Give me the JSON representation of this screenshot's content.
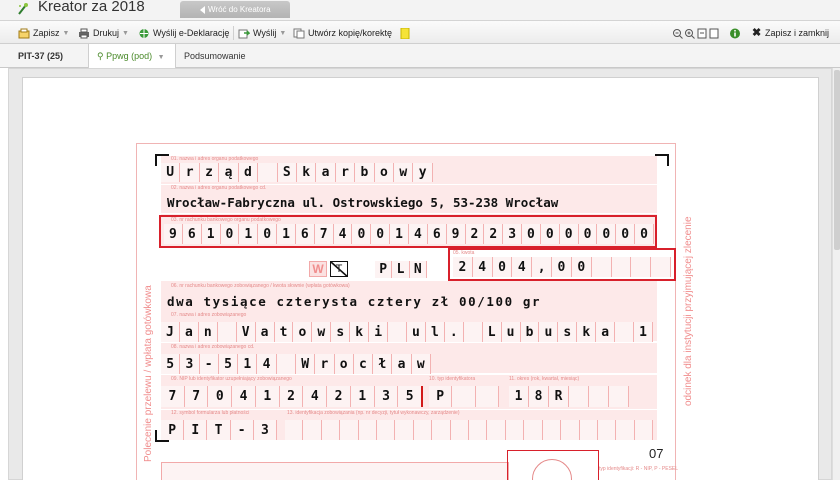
{
  "app": {
    "title": "Kreator za 2018",
    "back_tab": "Wróć do Kreatora"
  },
  "toolbar": {
    "save": "Zapisz",
    "print": "Drukuj",
    "send_edeklaracje": "Wyślij e-Deklarację",
    "send": "Wyślij",
    "copy": "Utwórz kopię/korektę",
    "save_close": "Zapisz i zamknij"
  },
  "tabs": [
    {
      "label": "PIT-37 (25)"
    },
    {
      "label": "Ppwg (pod)"
    },
    {
      "label": "Podsumowanie"
    }
  ],
  "form": {
    "vertical_left": "Polecenie przelewu / wpłata gotówkowa",
    "vertical_right": "odcinek dla instytucji przyjmującej zlecenie",
    "labels": {
      "f01": "01. nazwa i adres organu podatkowego",
      "f02": "02. nazwa i adres organu podatkowego cd.",
      "f03": "03. nr rachunku bankowego organu podatkowego",
      "f05": "05. kwota",
      "f06": "06. nr rachunku bankowego zobowiązanego / kwota słownie (wpłata gotówkowa)",
      "f07": "07. nazwa i adres zobowiązanego",
      "f08": "08. nazwa i adres zobowiązanego cd.",
      "f09": "09. NIP lub identyfikator uzupełniający zobowiązanego",
      "f10": "10. typ identyfikatora",
      "f11": "11. okres (rok, kwartał, miesiąc)",
      "f12": "12. symbol formularza lub płatności",
      "f13": "13. identyfikacja zobowiązania (np. nr decyzji, tytuł wykonawczy, zarządzenie)",
      "f14": "typ identyfikacji: R - NIP, P - PESEL"
    },
    "line1": "Urząd Skarbowy",
    "line2": "Wrocław-Fabryczna ul. Ostrowskiego 5, 53-238 Wrocław",
    "account": "96101016740014692230000000",
    "w_label": "W",
    "t_label": "T",
    "currency": "PLN",
    "amount": "2404,00",
    "words": "dwa tysiące czterysta cztery zł 00/100 gr",
    "name_line": "Jan Vatowski ul. Lubuska 1",
    "city_line": "53-514 Wrocław",
    "nip": "7704124213",
    "nip_suffix": "5",
    "id_type": "P",
    "period": "18R",
    "symbol": "PIT-37",
    "number_07": "07"
  }
}
